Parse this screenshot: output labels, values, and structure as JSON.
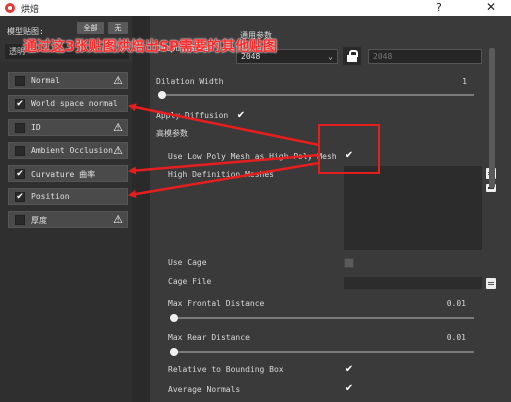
{
  "window": {
    "title": "烘焙",
    "help_glyph": "?",
    "close_glyph": "✕"
  },
  "left": {
    "maps_label": "模型贴图:",
    "select_all": "全部",
    "select_none": "无",
    "select_value": "透明",
    "maps": [
      {
        "label": "Normal",
        "checked": false,
        "warning": true
      },
      {
        "label": "World space normal",
        "checked": true,
        "warning": false
      },
      {
        "label": "ID",
        "checked": false,
        "warning": true
      },
      {
        "label": "Ambient Occlusion",
        "checked": false,
        "warning": true
      },
      {
        "label": "Curvature 曲率",
        "checked": true,
        "warning": false
      },
      {
        "label": "Position",
        "checked": true,
        "warning": false
      },
      {
        "label": "厚度",
        "checked": false,
        "warning": true
      }
    ]
  },
  "right": {
    "common_params": "通用参数",
    "output_size_label": "Output Size",
    "output_size_value": "2048",
    "output_size_locked_value": "2048",
    "dilation_label": "Dilation Width",
    "dilation_value": "1",
    "apply_diffusion_label": "Apply Diffusion",
    "high_poly_section": "高模参数",
    "use_low_poly_label": "Use Low Poly Mesh as High Poly Mesh",
    "hd_meshes_label": "High Definition Meshes",
    "use_cage_label": "Use Cage",
    "cage_file_label": "Cage File",
    "max_frontal_label": "Max Frontal Distance",
    "max_frontal_value": "0.01",
    "max_rear_label": "Max Rear Distance",
    "max_rear_value": "0.01",
    "relative_bbox_label": "Relative to Bounding Box",
    "average_normals_label": "Average Normals"
  },
  "annotation": {
    "text": "通过这3张贴图烘焙出SP需要的其他贴图",
    "color": "#ff2a2a"
  },
  "icons": {
    "warning": "⚠",
    "check": "✔",
    "chevron": "⌄"
  }
}
